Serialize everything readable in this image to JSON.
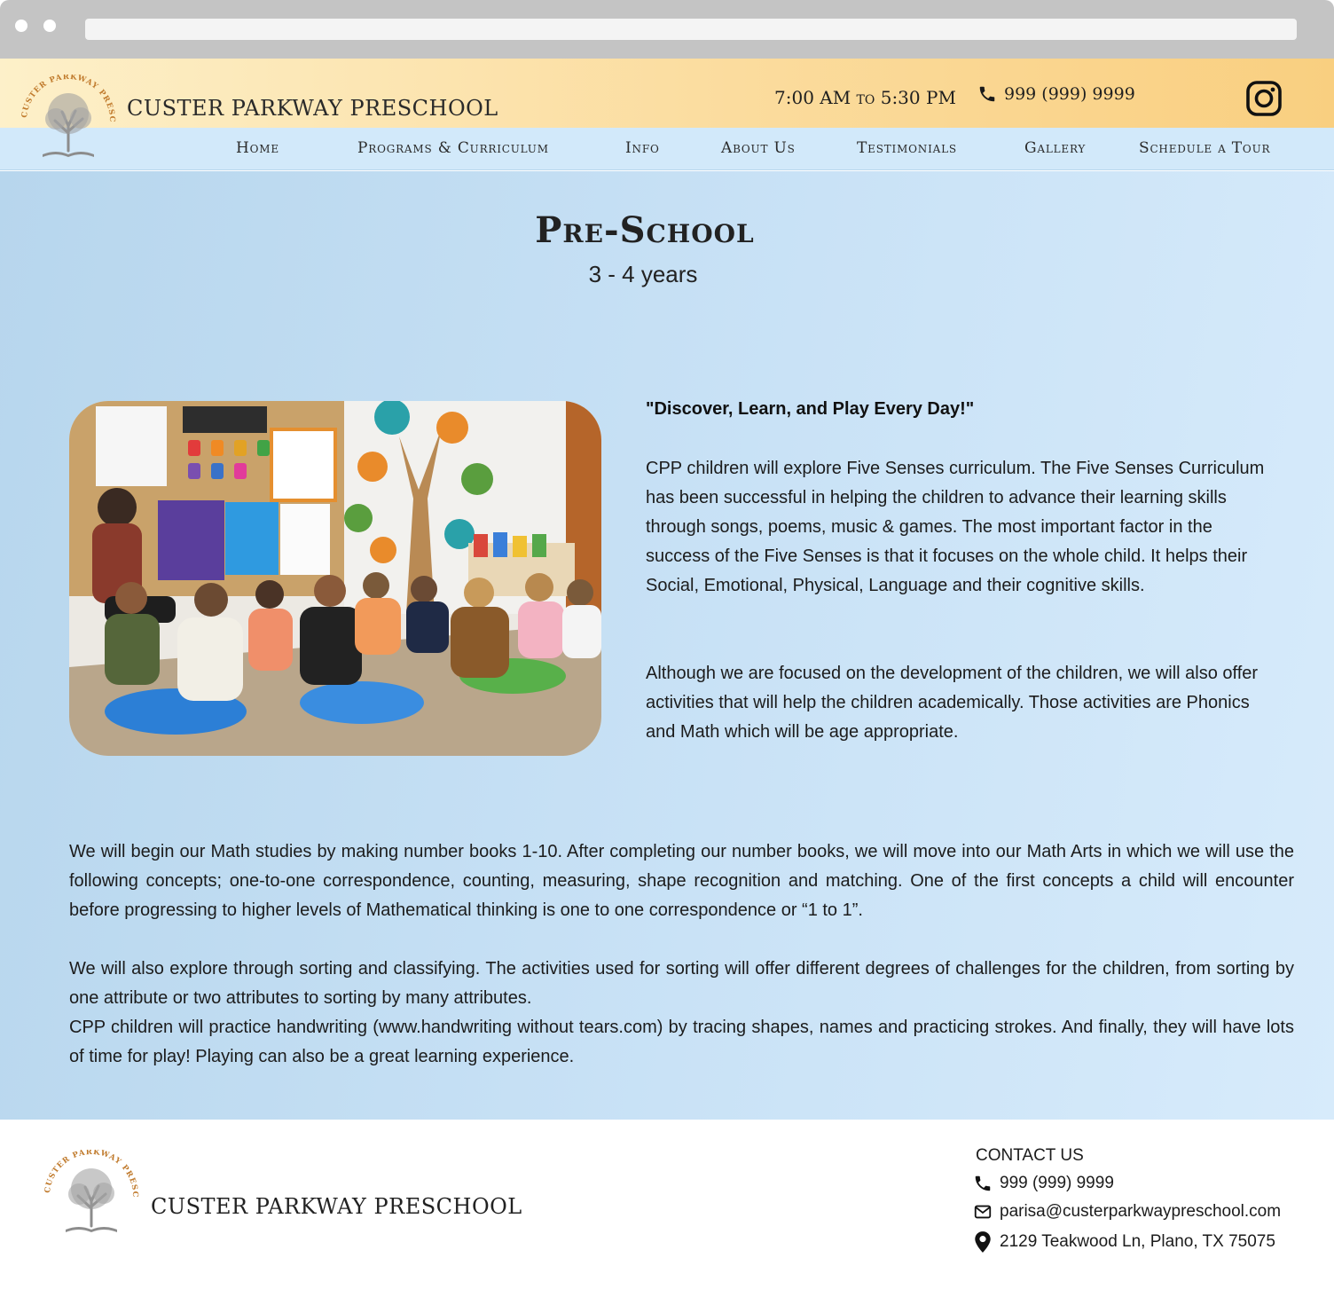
{
  "header": {
    "brand": "CUSTER PARKWAY PRESCHOOL",
    "logo_arc_text": "CUSTER PARKWAY PRESCHOOL",
    "hours": "7:00 AM to 5:30 PM",
    "phone": "999 (999) 9999",
    "instagram_icon": "instagram-icon",
    "accent_gradient": [
      "#fdf0c9",
      "#f9cf80"
    ],
    "nav_bg": "#d2e9fa"
  },
  "nav": {
    "items": [
      {
        "label": "Home"
      },
      {
        "label": "Programs & Curriculum"
      },
      {
        "label": "Info"
      },
      {
        "label": "About Us"
      },
      {
        "label": "Testimonials"
      },
      {
        "label": "Gallery"
      },
      {
        "label": "Schedule a Tour"
      }
    ]
  },
  "main": {
    "title": "Pre-School",
    "subtitle": "3 - 4 years",
    "photo_icon": "classroom-photo",
    "tagline": "\"Discover, Learn, and Play Every Day!\"",
    "paragraphs": [
      "CPP children will explore Five Senses curriculum. The Five Senses Curriculum has been successful in helping the children to advance their learning skills through songs, poems, music & games. The most important factor in the success of the Five Senses is that it focuses on the whole child. It helps their Social, Emotional, Physical, Language and their cognitive skills.",
      "Although we are focused on the development of the children, we will also offer activities that will help the children academically. Those activities are Phonics and Math which will be age appropriate.",
      "We will begin our Math studies by making number books 1-10. After completing our number books, we will move into our Math Arts in which we will use the following concepts; one-to-one correspondence, counting, measuring, shape recognition and matching. One of the first concepts a child will encounter before progressing to higher levels of Mathematical thinking is one to one correspondence or “1 to 1”.",
      "We will also explore through sorting and classifying. The activities used for sorting will offer different degrees of challenges for the children, from sorting by one attribute or two attributes to sorting by many attributes.",
      "CPP children will practice handwriting (www.handwriting without tears.com) by tracing shapes, names and practicing strokes. And finally, they will have lots of time for play! Playing can also be a great learning experience."
    ],
    "bg_gradient": [
      "#b7d6ed",
      "#d7ebfb"
    ]
  },
  "footer": {
    "brand": "CUSTER PARKWAY PRESCHOOL",
    "contact_title": "CONTACT US",
    "phone": "999 (999) 9999",
    "email": "parisa@custerparkwaypreschool.com",
    "address": "2129 Teakwood Ln, Plano, TX 75075",
    "icons": [
      "phone-icon",
      "email-icon",
      "location-icon"
    ]
  }
}
